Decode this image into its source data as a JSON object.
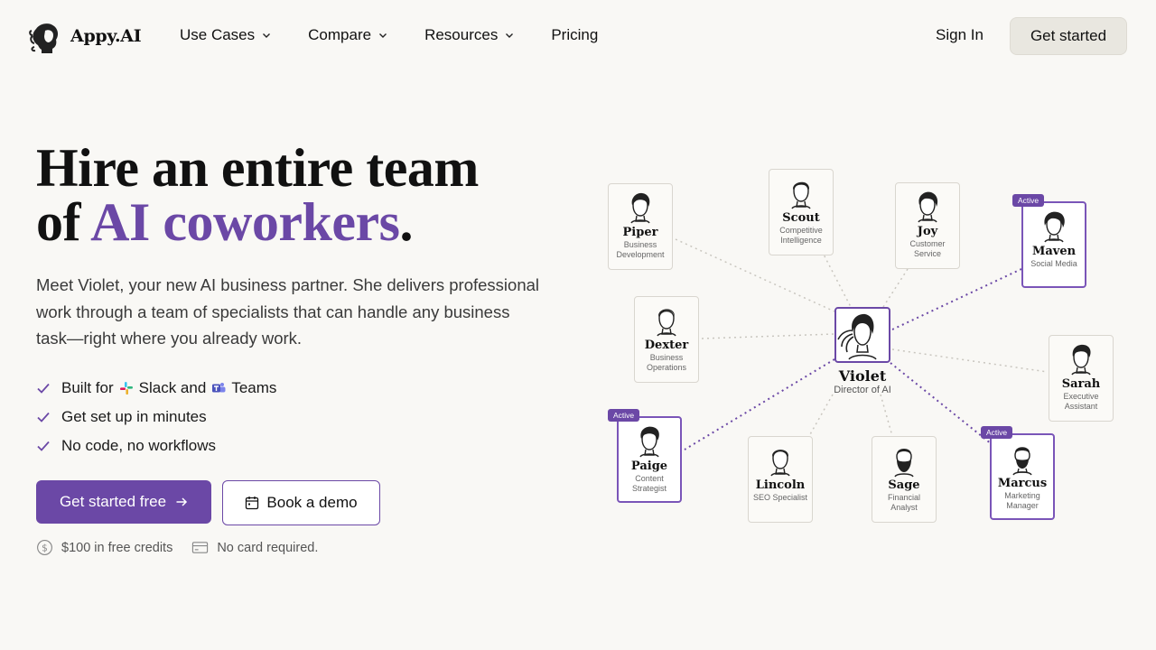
{
  "brand": {
    "name": "Appy.AI",
    "logo_icon": "woman-profile-logo-icon"
  },
  "nav": {
    "items": [
      {
        "label": "Use Cases",
        "has_dropdown": true
      },
      {
        "label": "Compare",
        "has_dropdown": true
      },
      {
        "label": "Resources",
        "has_dropdown": true
      },
      {
        "label": "Pricing",
        "has_dropdown": false
      }
    ],
    "sign_in": "Sign In",
    "get_started": "Get started"
  },
  "hero": {
    "title_line1": "Hire an entire team",
    "title_of": "of ",
    "title_accent": "AI coworkers",
    "title_period": ".",
    "description": "Meet Violet, your new AI business partner. She delivers professional work through a team of specialists that can handle any business task—right where you already work.",
    "checks": {
      "built_for": "Built for",
      "slack": "Slack and",
      "teams": "Teams",
      "setup": "Get set up in minutes",
      "nocode": "No code, no workflows"
    },
    "primary_cta": "Get started free",
    "secondary_cta": "Book a demo",
    "credits_note": "$100 in free credits",
    "card_note": "No card required."
  },
  "colors": {
    "accent": "#6b48a6",
    "background": "#f9f8f5"
  },
  "org": {
    "center": {
      "name": "Violet",
      "role": "Director of AI"
    },
    "active_label": "Active",
    "agents": {
      "piper": {
        "name": "Piper",
        "role": "Business Development"
      },
      "scout": {
        "name": "Scout",
        "role": "Competitive Intelligence"
      },
      "joy": {
        "name": "Joy",
        "role": "Customer Service"
      },
      "maven": {
        "name": "Maven",
        "role": "Social Media"
      },
      "dexter": {
        "name": "Dexter",
        "role": "Business Operations"
      },
      "sarah": {
        "name": "Sarah",
        "role": "Executive Assistant"
      },
      "paige": {
        "name": "Paige",
        "role": "Content Strategist"
      },
      "lincoln": {
        "name": "Lincoln",
        "role": "SEO Specialist"
      },
      "sage": {
        "name": "Sage",
        "role": "Financial Analyst"
      },
      "marcus": {
        "name": "Marcus",
        "role": "Marketing Manager"
      }
    }
  }
}
